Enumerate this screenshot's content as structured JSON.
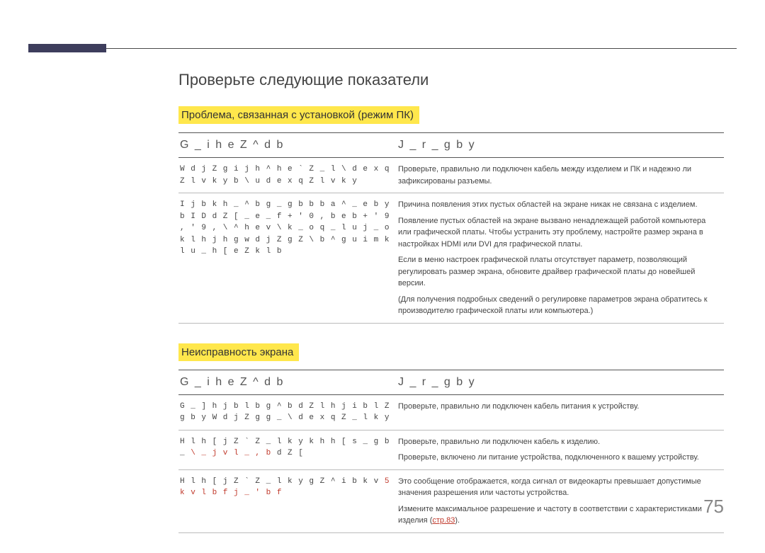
{
  "title": "Проверьте следующие показатели",
  "section1": {
    "label": "Проблема, связанная с установкой (режим ПК)",
    "col1": "G _ i h e Z ^ d b",
    "col2": "J _ r _ g b y",
    "rows": [
      {
        "left": "W d j Z g   i j h ^ h e ` Z _ l   \\ d e x q Z l v k y   b   \\ u d e x q Z l v k y",
        "right": [
          "Проверьте, правильно ли подключен кабель между изделием и ПК и надежно ли зафиксированы разъемы."
        ]
      },
      {
        "left": "I j b   k h _ ^ b g _ g b b   b a ^ _ e b y   b   I D   d Z [ _ e _ f   + ' 0 ,   b e b   + ' 9 , ' 9 ,   \\ ^ h e v   \\ k _ o   q _ l u j _ o   k l h j h g   w d j Z g Z   \\ b ^ g u   i m k l u _   h [ e Z k l b",
        "right": [
          "Причина появления этих пустых областей на экране никак не связана с изделием.",
          "Появление пустых областей на экране вызвано ненадлежащей работой компьютера или графической платы. Чтобы устранить эту проблему, настройте размер экрана в настройках HDMI или DVI для графической платы.",
          "Если в меню настроек графической платы отсутствует параметр, позволяющий регулировать размер экрана, обновите драйвер графической платы до новейшей версии.",
          "(Для получения подробных сведений о регулировке параметров экрана обратитесь к производителю графической платы или компьютера.)"
        ]
      }
    ]
  },
  "section2": {
    "label": "Неисправность экрана",
    "col1": "G _ i h e Z ^ d b",
    "col2": "J _ r _ g b y",
    "rows": [
      {
        "left": "G _   ] h j b l   b g ^ b d Z l h j   i b l Z g b y     W d j Z g   g _   \\ d e x q Z _ l k y",
        "right": [
          "Проверьте, правильно ли подключен кабель питания к устройству."
        ]
      },
      {
        "left_pre": "H l h [ j Z ` Z _ l k y   k h h [ s _ g b _   ",
        "left_red": "\\ _ j v l _ , b",
        "left_post": "   d Z [",
        "right": [
          "Проверьте, правильно ли подключен кабель к изделию.",
          "Проверьте, включено ли питание устройства, подключенного к вашему устройству."
        ]
      },
      {
        "left_pre": "H l h [ j Z ` Z _ l k y   g Z ^ i b k v   ",
        "left_red": "5 k v l b f   j _ ' b f",
        "left_post": "",
        "right": [
          "Это сообщение отображается, когда сигнал от видеокарты превышает допустимые значения разрешения или частоты устройства.",
          "__LINK__"
        ],
        "linktext_pre": "Измените максимальное разрешение и частоту в соответствии с характеристиками изделия (",
        "linktext_link": "стр.83",
        "linktext_post": ")."
      }
    ]
  },
  "pagenum": "75"
}
